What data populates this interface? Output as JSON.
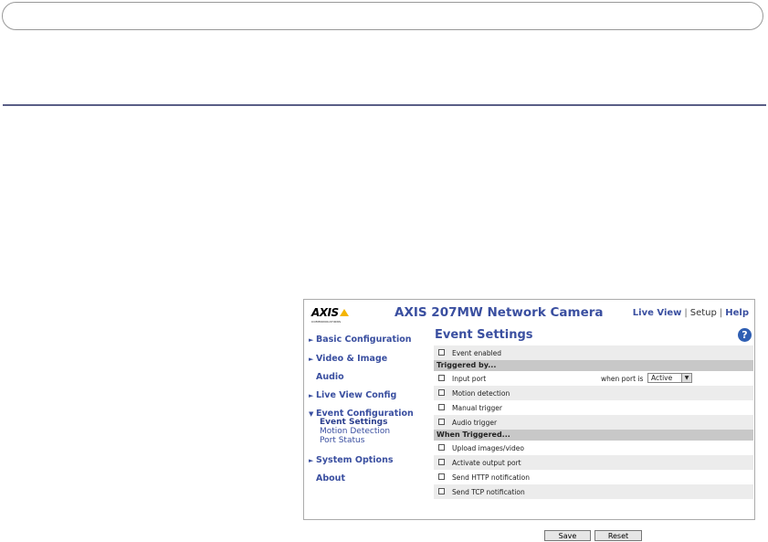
{
  "header": {
    "logo": "AXIS",
    "logo_sub": "COMMUNICATIONS",
    "title": "AXIS 207MW Network Camera",
    "links": {
      "live_view": "Live View",
      "setup": "Setup",
      "help": "Help",
      "sep": "|"
    }
  },
  "nav": {
    "basic": "Basic Configuration",
    "video": "Video & Image",
    "audio": "Audio",
    "liveview": "Live View Config",
    "event": "Event Configuration",
    "event_settings": "Event Settings",
    "motion": "Motion Detection",
    "port": "Port Status",
    "system": "System Options",
    "about": "About"
  },
  "content": {
    "title": "Event Settings",
    "help_icon": "?",
    "event_enabled": "Event enabled",
    "triggered_by": "Triggered by...",
    "input_port": "Input port",
    "when_port_is": "when port is",
    "port_state": "Active",
    "motion_detection": "Motion detection",
    "manual_trigger": "Manual trigger",
    "audio_trigger": "Audio trigger",
    "when_triggered": "When Triggered...",
    "upload": "Upload images/video",
    "activate_output": "Activate output port",
    "send_http": "Send HTTP notification",
    "send_tcp": "Send TCP notification",
    "save": "Save",
    "reset": "Reset"
  },
  "colors": {
    "accent": "#3a4fa0",
    "rule": "#5a5e86",
    "logo_triangle": "#f4b400"
  }
}
